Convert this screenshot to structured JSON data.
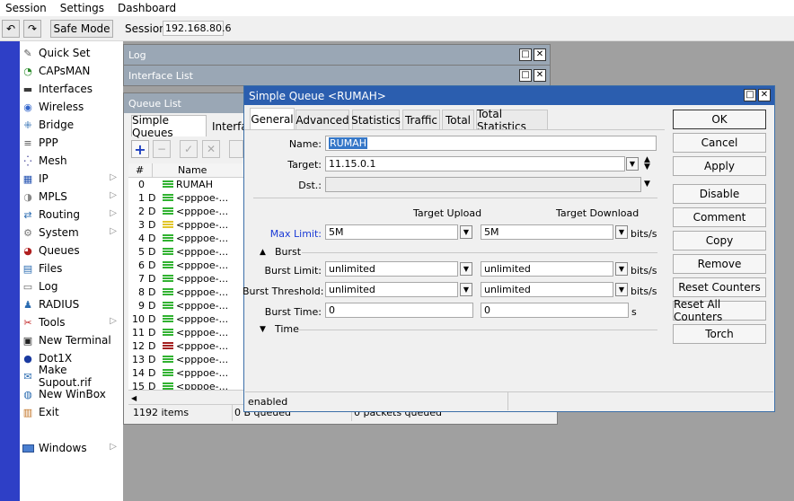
{
  "menubar": {
    "items": [
      "Session",
      "Settings",
      "Dashboard"
    ]
  },
  "toolbar": {
    "safe_mode": "Safe Mode",
    "session_label": "Session:",
    "session_value": "192.168.80.6"
  },
  "sidebar": {
    "items": [
      {
        "label": "Quick Set",
        "icon": "wand-icon",
        "submenu": false
      },
      {
        "label": "CAPsMAN",
        "icon": "capsman-icon",
        "submenu": false
      },
      {
        "label": "Interfaces",
        "icon": "interfaces-icon",
        "submenu": false
      },
      {
        "label": "Wireless",
        "icon": "wireless-icon",
        "submenu": false
      },
      {
        "label": "Bridge",
        "icon": "bridge-icon",
        "submenu": false
      },
      {
        "label": "PPP",
        "icon": "ppp-icon",
        "submenu": false
      },
      {
        "label": "Mesh",
        "icon": "mesh-icon",
        "submenu": false
      },
      {
        "label": "IP",
        "icon": "ip-icon",
        "submenu": true
      },
      {
        "label": "MPLS",
        "icon": "mpls-icon",
        "submenu": true
      },
      {
        "label": "Routing",
        "icon": "routing-icon",
        "submenu": true
      },
      {
        "label": "System",
        "icon": "system-icon",
        "submenu": true
      },
      {
        "label": "Queues",
        "icon": "queues-icon",
        "submenu": false
      },
      {
        "label": "Files",
        "icon": "files-icon",
        "submenu": false
      },
      {
        "label": "Log",
        "icon": "log-icon",
        "submenu": false
      },
      {
        "label": "RADIUS",
        "icon": "radius-icon",
        "submenu": false
      },
      {
        "label": "Tools",
        "icon": "tools-icon",
        "submenu": true
      },
      {
        "label": "New Terminal",
        "icon": "terminal-icon",
        "submenu": false
      },
      {
        "label": "Dot1X",
        "icon": "dot1x-icon",
        "submenu": false
      },
      {
        "label": "Make Supout.rif",
        "icon": "supout-icon",
        "submenu": false
      },
      {
        "label": "New WinBox",
        "icon": "winbox-icon",
        "submenu": false
      },
      {
        "label": "Exit",
        "icon": "exit-icon",
        "submenu": false
      }
    ],
    "windows": "Windows"
  },
  "log_window": {
    "title": "Log"
  },
  "interface_window": {
    "title": "Interface List"
  },
  "queue_window": {
    "title": "Queue List",
    "tabs": [
      "Simple Queues",
      "Interfa"
    ],
    "columns": [
      "#",
      "Name"
    ],
    "rows": [
      {
        "num": "0",
        "flag": "",
        "name": "RUMAH",
        "color": "#31b231"
      },
      {
        "num": "1",
        "flag": "D",
        "name": "<pppoe-...",
        "color": "#31b231"
      },
      {
        "num": "2",
        "flag": "D",
        "name": "<pppoe-...",
        "color": "#31b231"
      },
      {
        "num": "3",
        "flag": "D",
        "name": "<pppoe-...",
        "color": "#e1c52a"
      },
      {
        "num": "4",
        "flag": "D",
        "name": "<pppoe-...",
        "color": "#31b231"
      },
      {
        "num": "5",
        "flag": "D",
        "name": "<pppoe-...",
        "color": "#31b231"
      },
      {
        "num": "6",
        "flag": "D",
        "name": "<pppoe-...",
        "color": "#31b231"
      },
      {
        "num": "7",
        "flag": "D",
        "name": "<pppoe-...",
        "color": "#31b231"
      },
      {
        "num": "8",
        "flag": "D",
        "name": "<pppoe-...",
        "color": "#31b231"
      },
      {
        "num": "9",
        "flag": "D",
        "name": "<pppoe-...",
        "color": "#31b231"
      },
      {
        "num": "10",
        "flag": "D",
        "name": "<pppoe-...",
        "color": "#31b231"
      },
      {
        "num": "11",
        "flag": "D",
        "name": "<pppoe-...",
        "color": "#31b231"
      },
      {
        "num": "12",
        "flag": "D",
        "name": "<pppoe-...",
        "color": "#a42020"
      },
      {
        "num": "13",
        "flag": "D",
        "name": "<pppoe-...",
        "color": "#31b231"
      },
      {
        "num": "14",
        "flag": "D",
        "name": "<pppoe-...",
        "color": "#31b231"
      },
      {
        "num": "15",
        "flag": "D",
        "name": "<pppoe-...",
        "color": "#31b231"
      }
    ],
    "status": {
      "items": "1192 items",
      "queued": "0 B queued",
      "packets": "0 packets queued"
    }
  },
  "dialog": {
    "title": "Simple Queue <RUMAH>",
    "tabs": [
      "General",
      "Advanced",
      "Statistics",
      "Traffic",
      "Total",
      "Total Statistics"
    ],
    "name_label": "Name:",
    "name_value": "RUMAH",
    "target_label": "Target:",
    "target_value": "11.15.0.1",
    "dst_label": "Dst.:",
    "dst_value": "",
    "col_upload": "Target Upload",
    "col_download": "Target Download",
    "max_limit_label": "Max Limit:",
    "max_up": "5M",
    "max_down": "5M",
    "unit_bits": "bits/s",
    "burst_section": "Burst",
    "burst_limit_label": "Burst Limit:",
    "burst_limit_up": "unlimited",
    "burst_limit_down": "unlimited",
    "burst_threshold_label": "Burst Threshold:",
    "burst_threshold_up": "unlimited",
    "burst_threshold_down": "unlimited",
    "burst_time_label": "Burst Time:",
    "burst_time_up": "0",
    "burst_time_down": "0",
    "unit_s": "s",
    "time_section": "Time",
    "buttons": [
      "OK",
      "Cancel",
      "Apply",
      "Disable",
      "Comment",
      "Copy",
      "Remove",
      "Reset Counters",
      "Reset All Counters",
      "Torch"
    ],
    "status": "enabled"
  },
  "colors": {
    "sidebar_strip": "#2e3fc6",
    "title_active": "#2b5eaf",
    "title_inactive": "#9aa7b5",
    "link_blue": "#1a3ad6"
  }
}
